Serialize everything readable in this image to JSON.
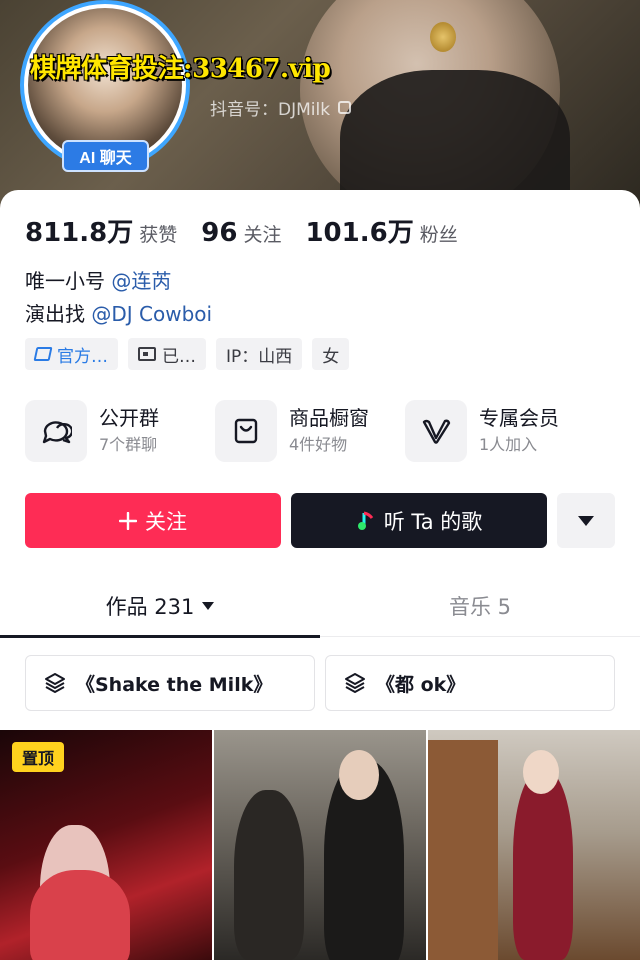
{
  "header": {
    "watermark": "棋牌体育投注:33467.vip",
    "douyin_id": "抖音号：DJMilk",
    "ai_badge": "AI 聊天"
  },
  "stats": [
    {
      "num": "811.8万",
      "label": "获赞"
    },
    {
      "num": "96",
      "label": "关注"
    },
    {
      "num": "101.6万",
      "label": "粉丝"
    }
  ],
  "bio": {
    "line1_prefix": "唯一小号 ",
    "line1_mention": "@连芮",
    "line2_prefix": "演出找 ",
    "line2_mention": "@DJ Cowboi"
  },
  "tags": {
    "official": "官方…",
    "id": "已…",
    "ip": "IP：山西",
    "gender": "女"
  },
  "features": [
    {
      "title": "公开群",
      "sub": "7个群聊",
      "icon": "chat-bubble-icon"
    },
    {
      "title": "商品橱窗",
      "sub": "4件好物",
      "icon": "shopping-bag-icon"
    },
    {
      "title": "专属会员",
      "sub": "1人加入",
      "icon": "vip-v-icon"
    }
  ],
  "actions": {
    "follow": "关注",
    "song": "听 Ta 的歌",
    "follow_icon": "plus-icon",
    "song_icon": "music-note-icon",
    "more_icon": "triangle-down-icon"
  },
  "tabs": {
    "works": "作品 231",
    "music": "音乐 5"
  },
  "collections": [
    {
      "label": "《Shake the Milk》",
      "icon": "stack-layers-icon"
    },
    {
      "label": "《都 ok》",
      "icon": "stack-layers-icon"
    }
  ],
  "grid": {
    "pin_label": "置顶"
  },
  "colors": {
    "accent_red": "#fe2c55",
    "dark": "#161823",
    "ai_blue": "#2c7be5",
    "mention_blue": "#2a5caa",
    "pin_yellow": "#ffd21e",
    "watermark_yellow": "#ffe600"
  }
}
